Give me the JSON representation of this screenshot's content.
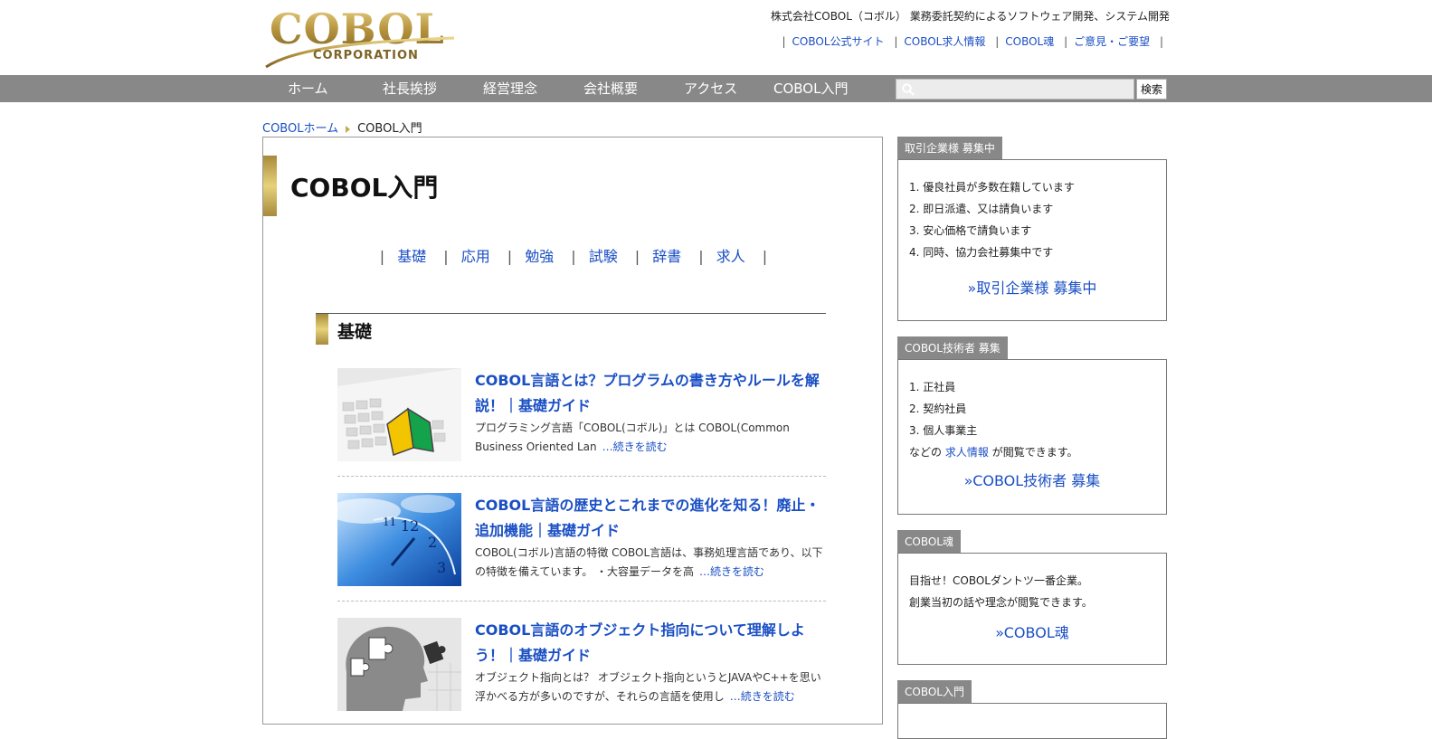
{
  "header": {
    "logo_text": "COBOL",
    "logo_sub": "CORPORATION",
    "tagline": "株式会社COBOL（コボル） 業務委託契約によるソフトウェア開発、システム開発",
    "links": [
      "COBOL公式サイト",
      "COBOL求人情報",
      "COBOL魂",
      "ご意見・ご要望"
    ]
  },
  "nav": {
    "items": [
      "ホーム",
      "社長挨拶",
      "経営理念",
      "会社概要",
      "アクセス",
      "COBOL入門"
    ],
    "search_placeholder": "",
    "search_button": "検索"
  },
  "breadcrumb": {
    "home": "COBOLホーム",
    "current": "COBOL入門"
  },
  "main": {
    "title": "COBOL入門",
    "subnav": [
      "基礎",
      "応用",
      "勉強",
      "試験",
      "辞書",
      "求人"
    ],
    "section_title": "基礎",
    "articles": [
      {
        "title": "COBOL言語とは？プログラムの書き方やルールを解説！｜基礎ガイド",
        "desc": "プログラミング言語「COBOL(コボル)」とは COBOL(Common Business Oriented Lan",
        "more": "…続きを読む",
        "thumb": "keyboard-beginner-mark"
      },
      {
        "title": "COBOL言語の歴史とこれまでの進化を知る！廃止・追加機能｜基礎ガイド",
        "desc": "COBOL(コボル)言語の特徴 COBOL言語は、事務処理言語であり、以下の特徴を備えています。 ・大容量データを高",
        "more": "…続きを読む",
        "thumb": "blue-clock"
      },
      {
        "title": "COBOL言語のオブジェクト指向について理解しよう！｜基礎ガイド",
        "desc": "オブジェクト指向とは？ オブジェクト指向というとJAVAやC++を思い浮かべる方が多いのですが、それらの言語を使用し",
        "more": "…続きを読む",
        "thumb": "puzzle-head"
      }
    ]
  },
  "sidebar": {
    "partners": {
      "label": "取引企業様 募集中",
      "items": [
        "1. 優良社員が多数在籍しています",
        "2. 即日派遣、又は請負います",
        "3. 安心価格で請負います",
        "4. 同時、協力会社募集中です"
      ],
      "link": "»取引企業様 募集中"
    },
    "engineers": {
      "label": "COBOL技術者 募集",
      "items": [
        "1. 正社員",
        "2. 契約社員",
        "3. 個人事業主"
      ],
      "note_pre": "などの",
      "note_link": "求人情報",
      "note_post": "が閲覧できます。",
      "link": "»COBOL技術者 募集"
    },
    "spirit": {
      "label": "COBOL魂",
      "lines": [
        "目指せ！COBOLダントツ一番企業。",
        "創業当初の話や理念が閲覧できます。"
      ],
      "link": "»COBOL魂"
    },
    "intro": {
      "label": "COBOL入門"
    }
  },
  "colors": {
    "nav_bg": "#888888",
    "link": "#1a4fc4",
    "gold": "#c8a94a"
  }
}
